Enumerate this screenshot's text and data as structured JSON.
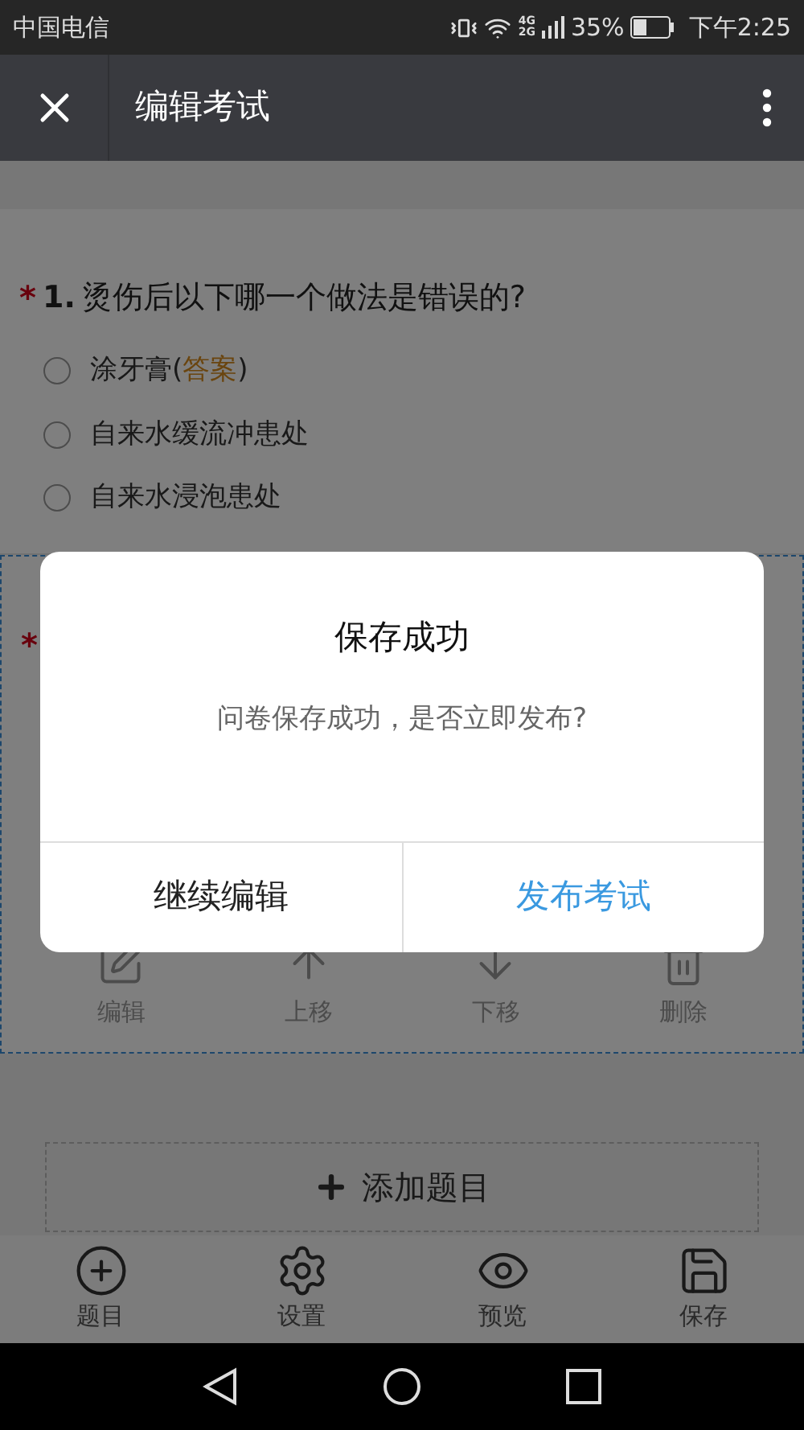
{
  "status_bar": {
    "carrier": "中国电信",
    "network": [
      "4G",
      "2G"
    ],
    "battery": "35%",
    "time": "下午2:25"
  },
  "header": {
    "title": "编辑考试"
  },
  "questions": [
    {
      "required_mark": "*",
      "number": "1.",
      "text": "烫伤后以下哪一个做法是错误的?",
      "selected": false,
      "options": [
        {
          "label": "涂牙膏",
          "answer": {
            "open": "(",
            "tag": "答案",
            "close": ")"
          },
          "checked": false
        },
        {
          "label": "自来水缓流冲患处",
          "checked": false
        },
        {
          "label": "自来水浸泡患处",
          "checked": false
        }
      ]
    },
    {
      "required_mark": "*",
      "selected": true,
      "actions": [
        {
          "kind": "edit",
          "label": "编辑"
        },
        {
          "kind": "up",
          "label": "上移"
        },
        {
          "kind": "down",
          "label": "下移"
        },
        {
          "kind": "delete",
          "label": "删除"
        }
      ]
    }
  ],
  "add_question": {
    "label": "添加题目"
  },
  "toolbar": [
    {
      "kind": "add",
      "label": "题目"
    },
    {
      "kind": "settings",
      "label": "设置"
    },
    {
      "kind": "preview",
      "label": "预览"
    },
    {
      "kind": "save",
      "label": "保存"
    }
  ],
  "dialog": {
    "title": "保存成功",
    "message": "问卷保存成功，是否立即发布?",
    "buttons": [
      {
        "kind": "secondary",
        "label": "继续编辑"
      },
      {
        "kind": "primary",
        "label": "发布考试"
      }
    ]
  }
}
